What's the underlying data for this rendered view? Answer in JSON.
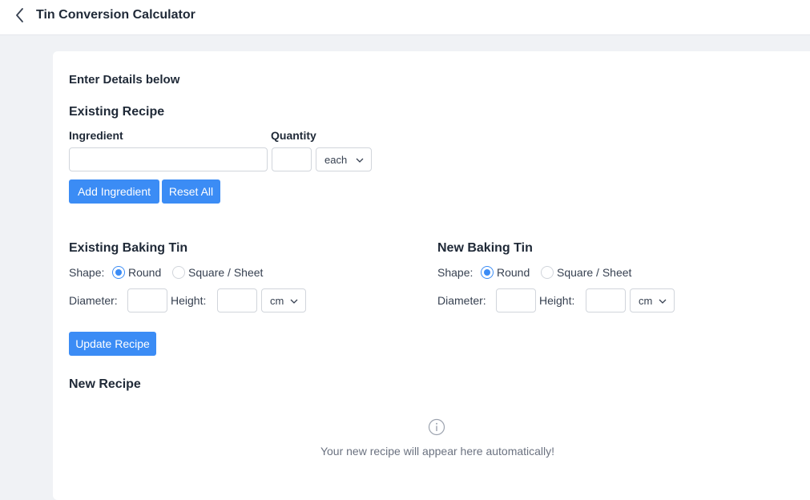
{
  "header": {
    "title": "Tin Conversion Calculator"
  },
  "form": {
    "intro": "Enter Details below",
    "existing_recipe": {
      "heading": "Existing Recipe",
      "ingredient_label": "Ingredient",
      "ingredient_value": "",
      "quantity_label": "Quantity",
      "quantity_value": "",
      "unit_selected": "each",
      "add_button": "Add Ingredient",
      "reset_button": "Reset All"
    },
    "existing_tin": {
      "heading": "Existing Baking Tin",
      "shape_label": "Shape:",
      "shape_round": "Round",
      "shape_square": "Square / Sheet",
      "shape_selected": "Round",
      "diameter_label": "Diameter:",
      "diameter_value": "",
      "height_label": "Height:",
      "height_value": "",
      "unit_selected": "cm"
    },
    "new_tin": {
      "heading": "New Baking Tin",
      "shape_label": "Shape:",
      "shape_round": "Round",
      "shape_square": "Square / Sheet",
      "shape_selected": "Round",
      "diameter_label": "Diameter:",
      "diameter_value": "",
      "height_label": "Height:",
      "height_value": "",
      "unit_selected": "cm"
    },
    "update_button": "Update Recipe",
    "new_recipe": {
      "heading": "New Recipe",
      "empty_message": "Your new recipe will appear here automatically!"
    }
  },
  "icons": {
    "back": "chevron-left-icon",
    "dropdown": "chevron-down-icon",
    "info": "info-circle-icon"
  },
  "colors": {
    "accent": "#3b8cf5",
    "page_bg": "#f0f2f5",
    "card_bg": "#ffffff"
  }
}
